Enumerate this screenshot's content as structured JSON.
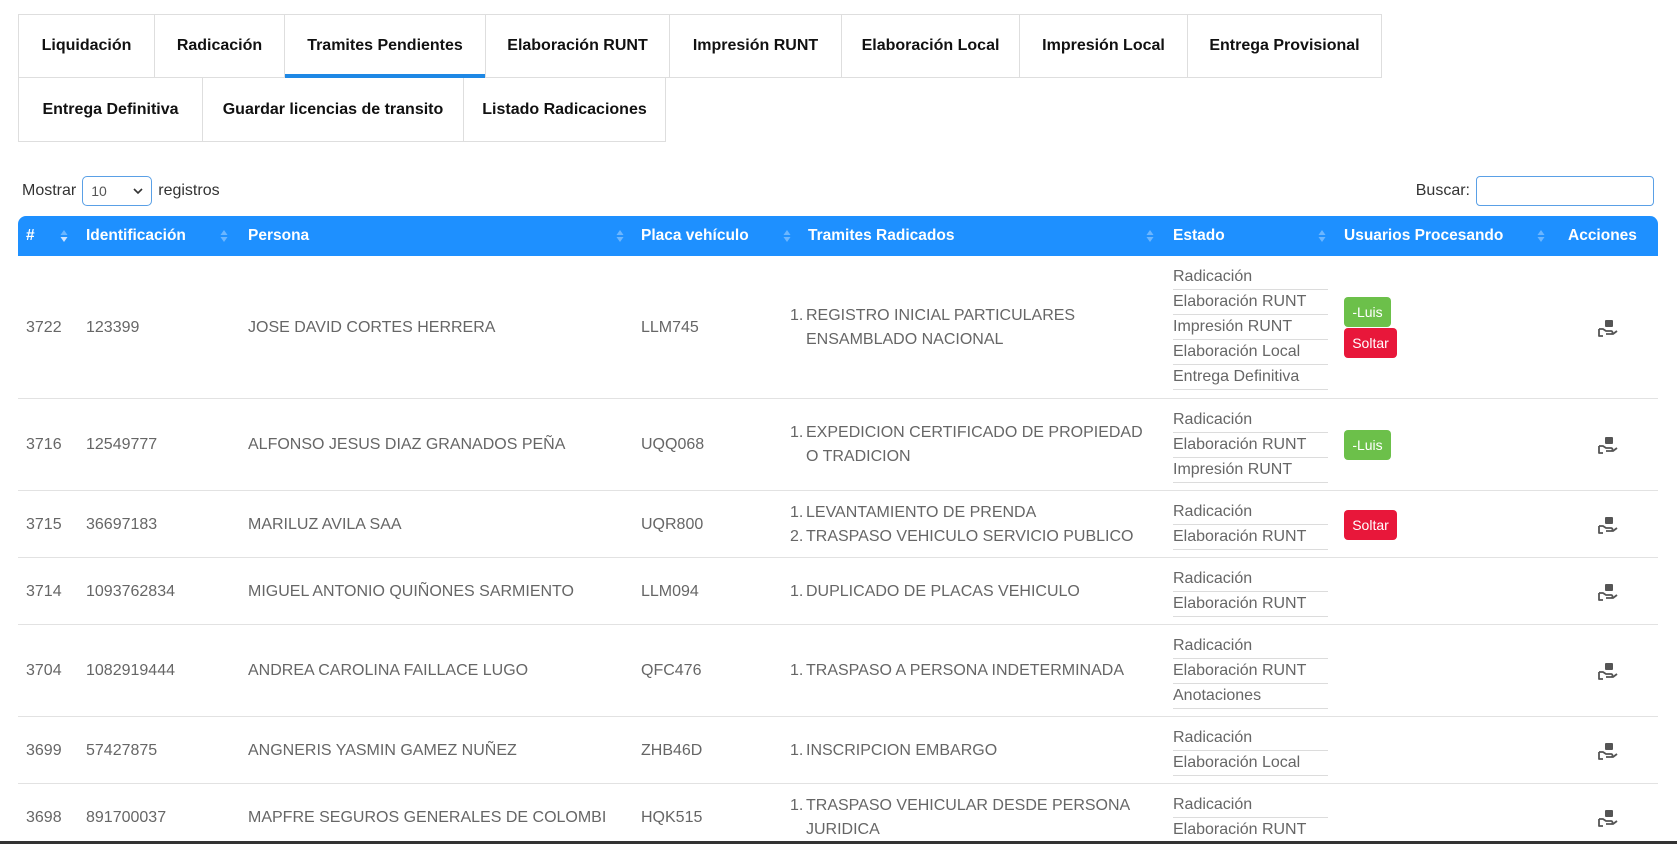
{
  "tabs": [
    [
      "Liquidación",
      "Radicación",
      "Tramites Pendientes",
      "Elaboración RUNT",
      "Impresión RUNT",
      "Elaboración Local",
      "Impresión Local",
      "Entrega Provisional"
    ],
    [
      "Entrega Definitiva",
      "Guardar licencias de transito",
      "Listado Radicaciones"
    ]
  ],
  "active_tab": "Tramites Pendientes",
  "controls": {
    "show_label": "Mostrar",
    "page_size": "10",
    "records_label": "registros",
    "search_label": "Buscar:",
    "search_value": ""
  },
  "table": {
    "headers": [
      "#",
      "Identificación",
      "Persona",
      "Placa vehículo",
      "Tramites Radicados",
      "Estado",
      "Usuarios Procesando",
      "Acciones"
    ],
    "header_color": "#1e90ff",
    "rows": [
      {
        "id": "3722",
        "identificacion": "123399",
        "persona": "JOSE DAVID CORTES HERRERA",
        "placa": "LLM745",
        "tramites": [
          "REGISTRO INICIAL PARTICULARES ENSAMBLADO NACIONAL"
        ],
        "estado": [
          "Radicación",
          "Elaboración RUNT",
          "Impresión RUNT",
          "Elaboración Local",
          "Entrega Definitiva"
        ],
        "usuarios": [
          "-Luis"
        ],
        "soltar": "Soltar"
      },
      {
        "id": "3716",
        "identificacion": "12549777",
        "persona": "ALFONSO JESUS DIAZ GRANADOS PEÑA",
        "placa": "UQQ068",
        "tramites": [
          "EXPEDICION CERTIFICADO DE PROPIEDAD O TRADICION"
        ],
        "estado": [
          "Radicación",
          "Elaboración RUNT",
          "Impresión RUNT"
        ],
        "usuarios": [
          "-Luis"
        ],
        "soltar": ""
      },
      {
        "id": "3715",
        "identificacion": "36697183",
        "persona": "MARILUZ AVILA SAA",
        "placa": "UQR800",
        "tramites": [
          "LEVANTAMIENTO DE PRENDA",
          "TRASPASO VEHICULO SERVICIO PUBLICO"
        ],
        "estado": [
          "Radicación",
          "Elaboración RUNT"
        ],
        "usuarios": [],
        "soltar": "Soltar"
      },
      {
        "id": "3714",
        "identificacion": "1093762834",
        "persona": "MIGUEL ANTONIO QUIÑONES SARMIENTO",
        "placa": "LLM094",
        "tramites": [
          "DUPLICADO DE PLACAS VEHICULO"
        ],
        "estado": [
          "Radicación",
          "Elaboración RUNT"
        ],
        "usuarios": [],
        "soltar": ""
      },
      {
        "id": "3704",
        "identificacion": "1082919444",
        "persona": "ANDREA CAROLINA FAILLACE LUGO",
        "placa": "QFC476",
        "tramites": [
          "TRASPASO A PERSONA INDETERMINADA"
        ],
        "estado": [
          "Radicación",
          "Elaboración RUNT",
          "Anotaciones"
        ],
        "usuarios": [],
        "soltar": ""
      },
      {
        "id": "3699",
        "identificacion": "57427875",
        "persona": "ANGNERIS YASMIN GAMEZ NUÑEZ",
        "placa": "ZHB46D",
        "tramites": [
          "INSCRIPCION EMBARGO"
        ],
        "estado": [
          "Radicación",
          "Elaboración Local"
        ],
        "usuarios": [],
        "soltar": ""
      },
      {
        "id": "3698",
        "identificacion": "891700037",
        "persona": "MAPFRE SEGUROS GENERALES DE COLOMBI",
        "placa": "HQK515",
        "tramites": [
          "TRASPASO VEHICULAR DESDE PERSONA JURIDICA"
        ],
        "estado": [
          "Radicación",
          "Elaboración RUNT"
        ],
        "usuarios": [],
        "soltar": ""
      }
    ]
  },
  "colors": {
    "accent": "#1e88e5",
    "badge_green": "#6cc04a",
    "badge_red": "#e8173a"
  },
  "icons": {
    "action": "hand-holding-box-icon",
    "sort": "sort-arrows-icon",
    "select": "chevron-down-icon"
  }
}
